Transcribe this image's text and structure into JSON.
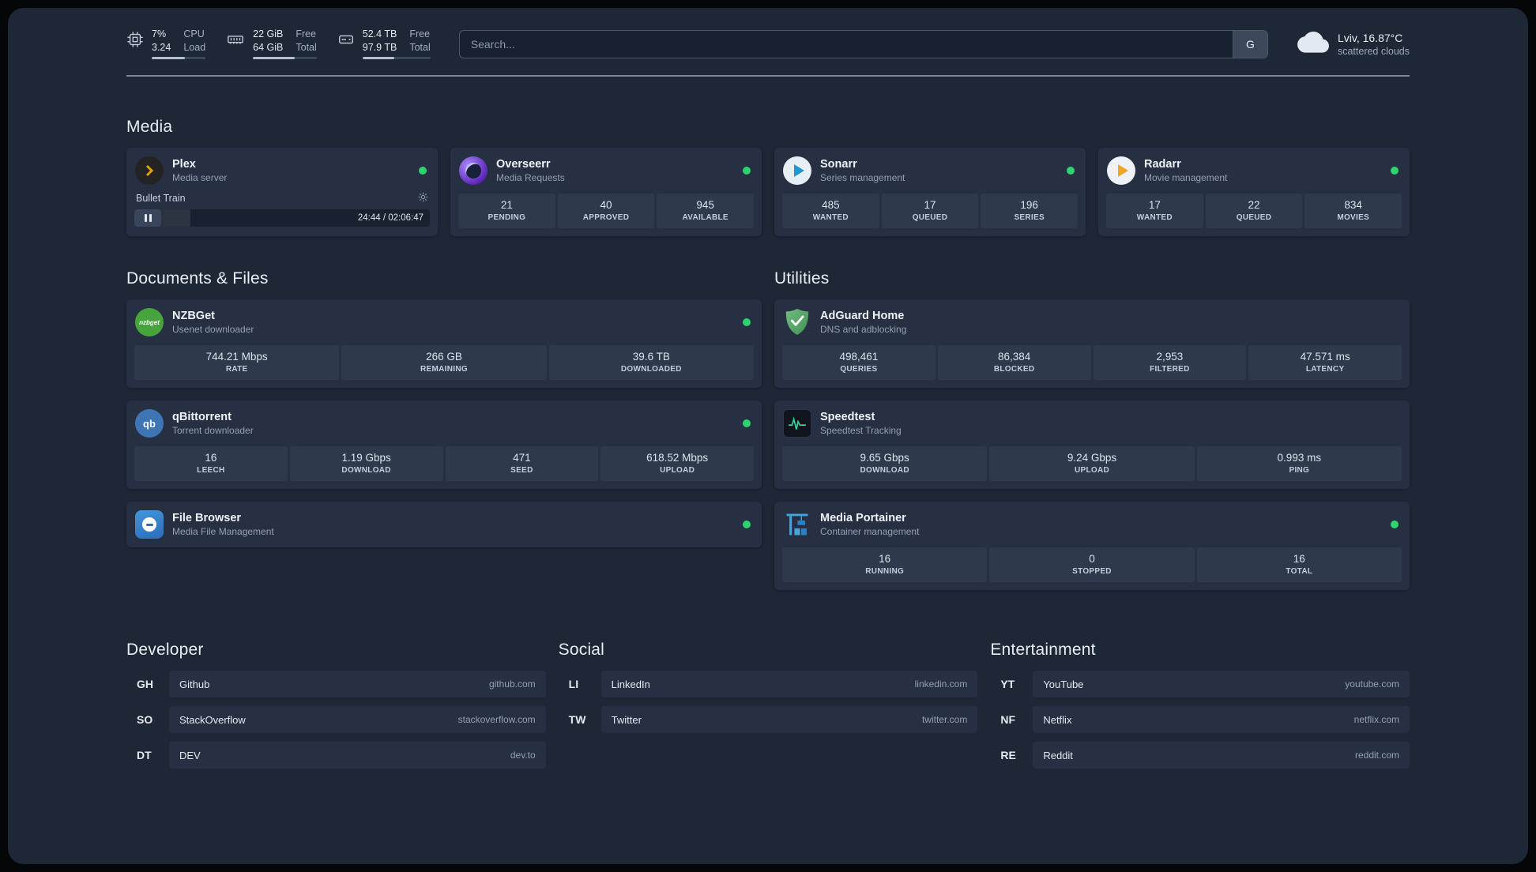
{
  "colors": {
    "background": "#1d2736",
    "card": "#263042",
    "status_online": "#2dd36f",
    "plex_accent": "#e5a00d"
  },
  "topbar": {
    "resources": [
      {
        "icon": "cpu-icon",
        "col1": [
          "7%",
          "3.24"
        ],
        "col2": [
          "CPU",
          "Load"
        ],
        "progress": 62
      },
      {
        "icon": "memory-icon",
        "col1": [
          "22 GiB",
          "64 GiB"
        ],
        "col2": [
          "Free",
          "Total"
        ],
        "progress": 66
      },
      {
        "icon": "disk-icon",
        "col1": [
          "52.4 TB",
          "97.9 TB"
        ],
        "col2": [
          "Free",
          "Total"
        ],
        "progress": 47
      }
    ],
    "search": {
      "placeholder": "Search...",
      "provider": "G"
    },
    "weather": {
      "icon": "cloud-icon",
      "location": "Lviv, 16.87°C",
      "condition": "scattered clouds"
    }
  },
  "groups": {
    "media": {
      "title": "Media",
      "services": [
        {
          "name": "Plex",
          "description": "Media server",
          "icon": "plex-icon",
          "online": true,
          "player": {
            "track": "Bullet Train",
            "time": "24:44 / 02:06:47",
            "progress": 19
          }
        },
        {
          "name": "Overseerr",
          "description": "Media Requests",
          "icon": "overseerr-icon",
          "online": true,
          "stats": [
            {
              "value": "21",
              "label": "PENDING"
            },
            {
              "value": "40",
              "label": "APPROVED"
            },
            {
              "value": "945",
              "label": "AVAILABLE"
            }
          ]
        },
        {
          "name": "Sonarr",
          "description": "Series management",
          "icon": "sonarr-icon",
          "online": true,
          "stats": [
            {
              "value": "485",
              "label": "WANTED"
            },
            {
              "value": "17",
              "label": "QUEUED"
            },
            {
              "value": "196",
              "label": "SERIES"
            }
          ]
        },
        {
          "name": "Radarr",
          "description": "Movie management",
          "icon": "radarr-icon",
          "online": true,
          "stats": [
            {
              "value": "17",
              "label": "WANTED"
            },
            {
              "value": "22",
              "label": "QUEUED"
            },
            {
              "value": "834",
              "label": "MOVIES"
            }
          ]
        }
      ]
    },
    "documents": {
      "title": "Documents & Files",
      "services": [
        {
          "name": "NZBGet",
          "description": "Usenet downloader",
          "icon": "nzbget-icon",
          "icon_text": "nzbget",
          "online": true,
          "stats": [
            {
              "value": "744.21 Mbps",
              "label": "RATE"
            },
            {
              "value": "266 GB",
              "label": "REMAINING"
            },
            {
              "value": "39.6 TB",
              "label": "DOWNLOADED"
            }
          ]
        },
        {
          "name": "qBittorrent",
          "description": "Torrent downloader",
          "icon": "qbittorrent-icon",
          "icon_text": "qb",
          "online": true,
          "stats": [
            {
              "value": "16",
              "label": "LEECH"
            },
            {
              "value": "1.19 Gbps",
              "label": "DOWNLOAD"
            },
            {
              "value": "471",
              "label": "SEED"
            },
            {
              "value": "618.52 Mbps",
              "label": "UPLOAD"
            }
          ]
        },
        {
          "name": "File Browser",
          "description": "Media File Management",
          "icon": "filebrowser-icon",
          "online": true,
          "stats": []
        }
      ]
    },
    "utilities": {
      "title": "Utilities",
      "services": [
        {
          "name": "AdGuard Home",
          "description": "DNS and adblocking",
          "icon": "adguard-icon",
          "online": false,
          "stats": [
            {
              "value": "498,461",
              "label": "QUERIES"
            },
            {
              "value": "86,384",
              "label": "BLOCKED"
            },
            {
              "value": "2,953",
              "label": "FILTERED"
            },
            {
              "value": "47.571 ms",
              "label": "LATENCY"
            }
          ]
        },
        {
          "name": "Speedtest",
          "description": "Speedtest Tracking",
          "icon": "speedtest-icon",
          "online": false,
          "stats": [
            {
              "value": "9.65 Gbps",
              "label": "DOWNLOAD"
            },
            {
              "value": "9.24 Gbps",
              "label": "UPLOAD"
            },
            {
              "value": "0.993 ms",
              "label": "PING"
            }
          ]
        },
        {
          "name": "Media Portainer",
          "description": "Container management",
          "icon": "portainer-icon",
          "online": true,
          "stats": [
            {
              "value": "16",
              "label": "RUNNING"
            },
            {
              "value": "0",
              "label": "STOPPED"
            },
            {
              "value": "16",
              "label": "TOTAL"
            }
          ]
        }
      ]
    }
  },
  "bookmarks": {
    "developer": {
      "title": "Developer",
      "items": [
        {
          "abbr": "GH",
          "name": "Github",
          "domain": "github.com"
        },
        {
          "abbr": "SO",
          "name": "StackOverflow",
          "domain": "stackoverflow.com"
        },
        {
          "abbr": "DT",
          "name": "DEV",
          "domain": "dev.to"
        }
      ]
    },
    "social": {
      "title": "Social",
      "items": [
        {
          "abbr": "LI",
          "name": "LinkedIn",
          "domain": "linkedin.com"
        },
        {
          "abbr": "TW",
          "name": "Twitter",
          "domain": "twitter.com"
        }
      ]
    },
    "entertainment": {
      "title": "Entertainment",
      "items": [
        {
          "abbr": "YT",
          "name": "YouTube",
          "domain": "youtube.com"
        },
        {
          "abbr": "NF",
          "name": "Netflix",
          "domain": "netflix.com"
        },
        {
          "abbr": "RE",
          "name": "Reddit",
          "domain": "reddit.com"
        }
      ]
    }
  }
}
